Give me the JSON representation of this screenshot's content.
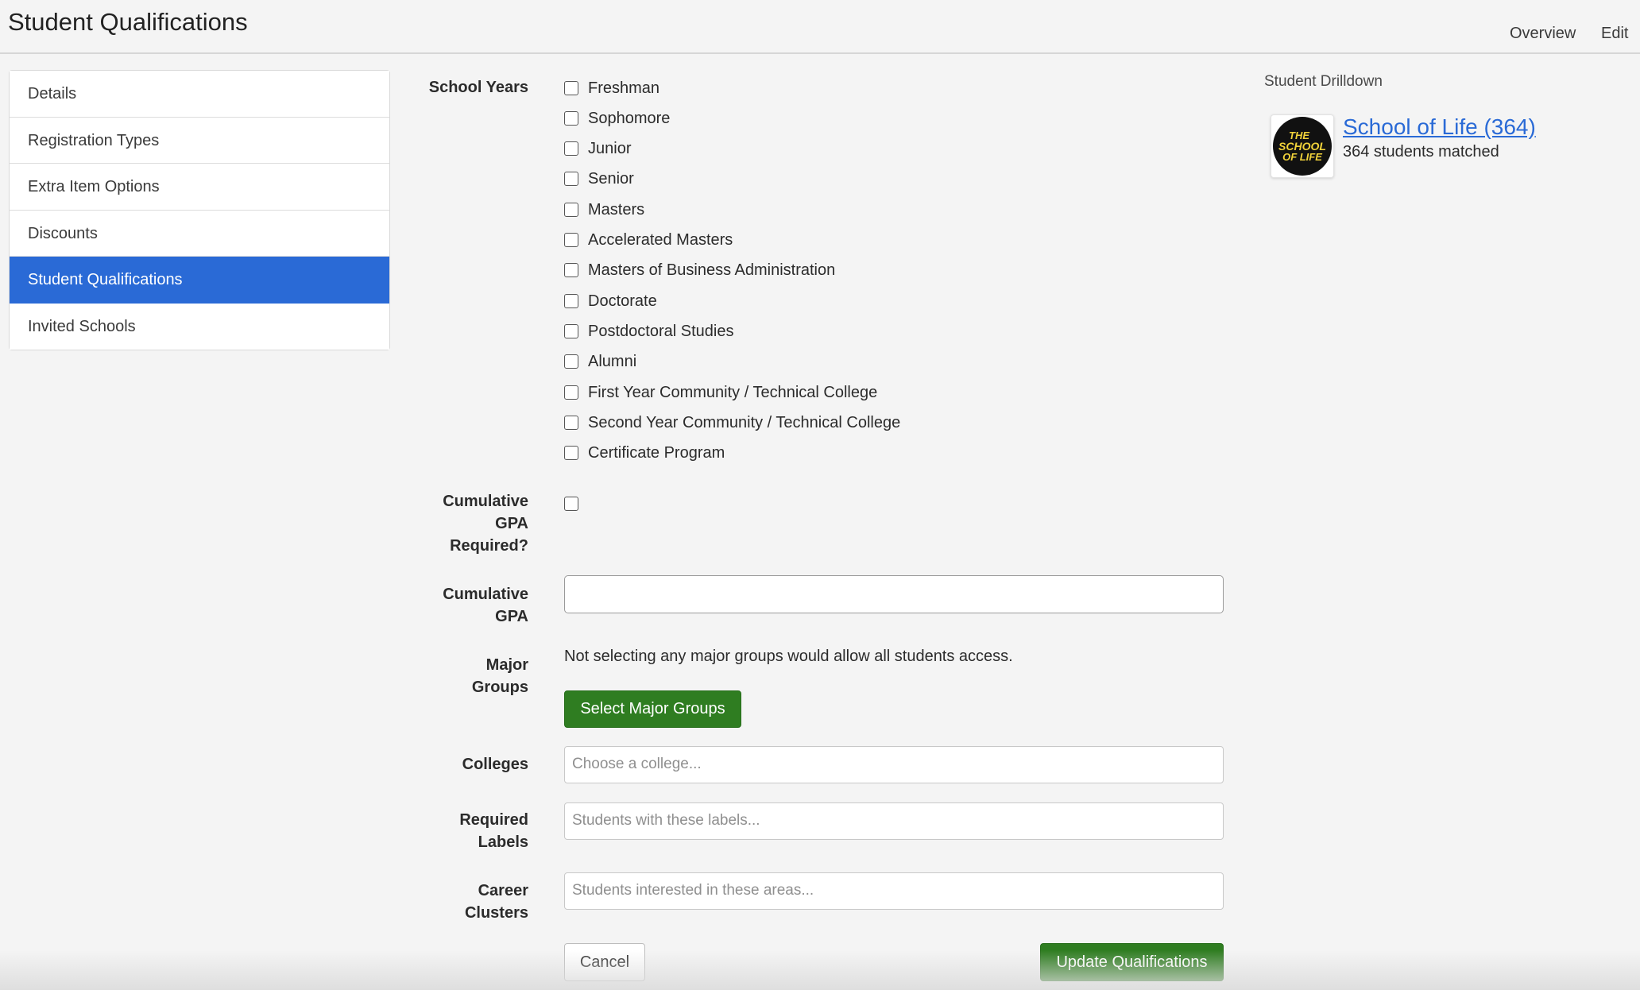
{
  "header": {
    "title": "Student Qualifications",
    "links": {
      "overview": "Overview",
      "edit": "Edit"
    }
  },
  "sidebar": {
    "items": [
      {
        "label": "Details"
      },
      {
        "label": "Registration Types"
      },
      {
        "label": "Extra Item Options"
      },
      {
        "label": "Discounts"
      },
      {
        "label": "Student Qualifications",
        "active": true
      },
      {
        "label": "Invited Schools"
      }
    ]
  },
  "form": {
    "school_years": {
      "label": "School Years",
      "options": [
        {
          "label": "Freshman",
          "checked": false
        },
        {
          "label": "Sophomore",
          "checked": false
        },
        {
          "label": "Junior",
          "checked": false
        },
        {
          "label": "Senior",
          "checked": false
        },
        {
          "label": "Masters",
          "checked": false
        },
        {
          "label": "Accelerated Masters",
          "checked": false
        },
        {
          "label": "Masters of Business Administration",
          "checked": false
        },
        {
          "label": "Doctorate",
          "checked": false
        },
        {
          "label": "Postdoctoral Studies",
          "checked": false
        },
        {
          "label": "Alumni",
          "checked": false
        },
        {
          "label": "First Year Community / Technical College",
          "checked": false
        },
        {
          "label": "Second Year Community / Technical College",
          "checked": false
        },
        {
          "label": "Certificate Program",
          "checked": false
        }
      ]
    },
    "gpa_required": {
      "label_lines": [
        "Cumulative",
        "GPA",
        "Required?"
      ],
      "checked": false
    },
    "cumulative_gpa": {
      "label_lines": [
        "Cumulative",
        "GPA"
      ],
      "value": ""
    },
    "major_groups": {
      "label_lines": [
        "Major",
        "Groups"
      ],
      "info": "Not selecting any major groups would allow all students access.",
      "button": "Select Major Groups"
    },
    "colleges": {
      "label": "Colleges",
      "placeholder": "Choose a college..."
    },
    "required_labels": {
      "label_lines": [
        "Required",
        "Labels"
      ],
      "placeholder": "Students with these labels..."
    },
    "career_clusters": {
      "label_lines": [
        "Career",
        "Clusters"
      ],
      "placeholder": "Students interested in these areas..."
    },
    "cancel_label": "Cancel",
    "submit_label": "Update Qualifications"
  },
  "drilldown": {
    "title": "Student Drilldown",
    "school_name": "School of Life (364)",
    "matched_text": "364 students matched",
    "logo_text": [
      "THE",
      "SCHOOL",
      "OF LIFE"
    ],
    "logo_colors": {
      "background": "#111111",
      "text": "#f2d33a"
    }
  }
}
